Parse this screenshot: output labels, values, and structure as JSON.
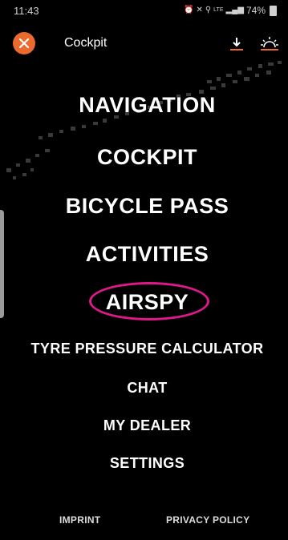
{
  "status_bar": {
    "time": "11:43",
    "indicators": "LTE",
    "battery": "74%"
  },
  "header": {
    "title": "Cockpit",
    "close_icon": "close-icon",
    "download_icon": "download-icon",
    "light_icon": "light-icon",
    "accent_color": "#ec6a2d"
  },
  "menu": {
    "items": [
      {
        "label": "NAVIGATION"
      },
      {
        "label": "COCKPIT"
      },
      {
        "label": "BICYCLE PASS"
      },
      {
        "label": "ACTIVITIES"
      },
      {
        "label": "AIRSPY"
      },
      {
        "label": "TYRE PRESSURE CALCULATOR"
      },
      {
        "label": "CHAT"
      },
      {
        "label": "MY DEALER"
      },
      {
        "label": "SETTINGS"
      }
    ],
    "highlight_color": "#e0188c"
  },
  "footer": {
    "imprint": "IMPRINT",
    "privacy": "PRIVACY POLICY"
  }
}
